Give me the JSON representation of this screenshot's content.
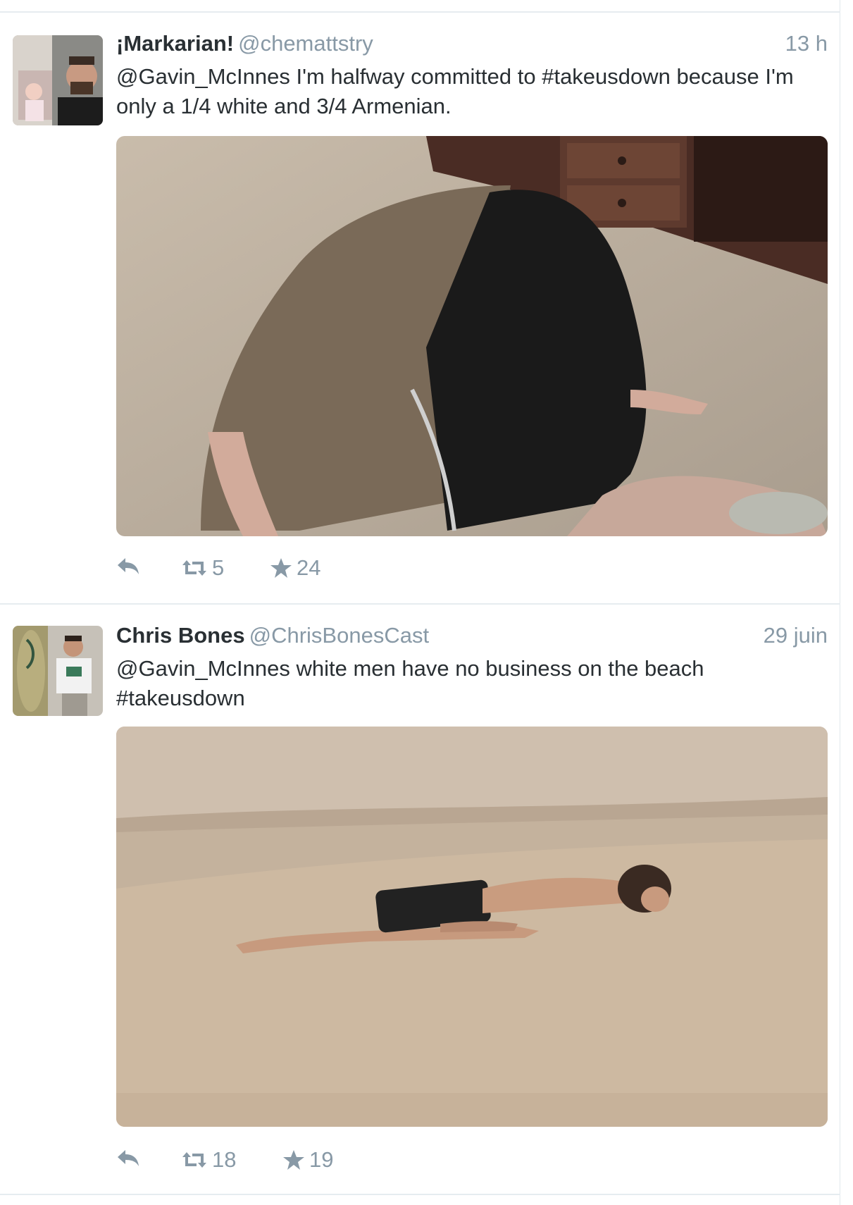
{
  "tweets": [
    {
      "fullname": "¡Markarian!",
      "username": "@chemattstry",
      "time": "13 h",
      "text": "@Gavin_McInnes I'm halfway committed to #takeusdown because I'm only a 1/4 white and 3/4 Armenian.",
      "avatar_icon": "avatar-photo",
      "media_icon": "photo",
      "reply_icon": "reply-icon",
      "retweet_icon": "retweet-icon",
      "retweet_count": "5",
      "favorite_icon": "star-icon",
      "favorite_count": "24"
    },
    {
      "fullname": "Chris Bones",
      "username": "@ChrisBonesCast",
      "time": "29 juin",
      "text": "@Gavin_McInnes white men have no business on the beach #takeusdown",
      "avatar_icon": "avatar-photo",
      "media_icon": "photo",
      "reply_icon": "reply-icon",
      "retweet_icon": "retweet-icon",
      "retweet_count": "18",
      "favorite_icon": "star-icon",
      "favorite_count": "19"
    }
  ],
  "colors": {
    "text": "#292f33",
    "meta": "#8899a6",
    "divider": "#e6ecf0"
  }
}
